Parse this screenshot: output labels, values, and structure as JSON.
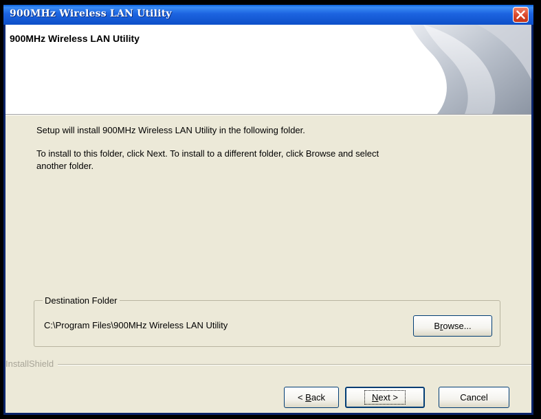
{
  "window": {
    "title": "900MHz Wireless LAN Utility",
    "close_icon": "close-icon"
  },
  "banner": {
    "title": "900MHz Wireless LAN Utility"
  },
  "content": {
    "line1": "Setup will install 900MHz Wireless LAN Utility in the following folder.",
    "line2a": "To install to this folder, click Next. To install to a different folder, click Browse and select",
    "line2b": "another folder."
  },
  "destination": {
    "group_label": "Destination Folder",
    "path": "C:\\Program Files\\900MHz Wireless LAN Utility",
    "browse_pre": "B",
    "browse_key": "r",
    "browse_post": "owse..."
  },
  "footer": {
    "brand": "InstallShield",
    "back_pre": "< ",
    "back_key": "B",
    "back_post": "ack",
    "next_key": "N",
    "next_post": "ext >",
    "cancel": "Cancel"
  },
  "colors": {
    "titlebar": "#0D4FC8",
    "dialog_bg": "#ECE9D8",
    "close_button": "#D9462A"
  }
}
